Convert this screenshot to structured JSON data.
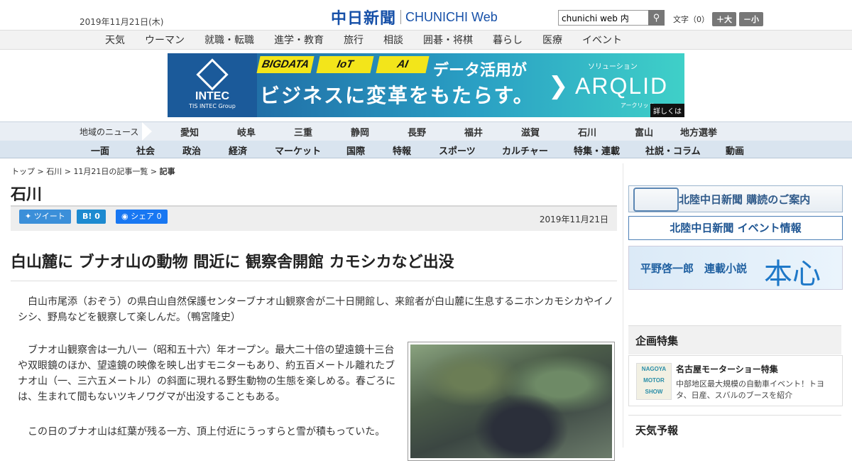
{
  "header": {
    "date": "2019年11月21日(木)",
    "logo_jp": "中日新聞",
    "logo_en": "CHUNICHI",
    "logo_web": "Web",
    "search_value": "chunichi web 内",
    "font_label": "文字（0）",
    "font_larger": "＋大",
    "font_smaller": "－小"
  },
  "service_nav": [
    "天気",
    "ウーマン",
    "就職・転職",
    "進学・教育",
    "旅行",
    "相談",
    "囲碁・将棋",
    "暮らし",
    "医療",
    "イベント"
  ],
  "ad": {
    "brand": "INTEC",
    "brand_sub": "TIS INTEC Group",
    "tags": [
      "BIGDATA",
      "IoT",
      "AI"
    ],
    "line1": "データ活用が",
    "line2": "ビジネスに変革をもたらす。",
    "solution": "ソリューション",
    "product": "ARQLID",
    "product_kana": "アークリッド",
    "more": "詳しくは"
  },
  "region_nav": {
    "lead": "地域のニュース",
    "items": [
      "愛知",
      "岐阜",
      "三重",
      "静岡",
      "長野",
      "福井",
      "滋賀",
      "石川",
      "富山",
      "地方選挙"
    ]
  },
  "category_nav": [
    "一面",
    "社会",
    "政治",
    "経済",
    "マーケット",
    "国際",
    "特報",
    "スポーツ",
    "カルチャー",
    "特集・連載",
    "社説・コラム",
    "動画"
  ],
  "breadcrumb": {
    "top": "トップ",
    "region": "石川",
    "list": "11月21日の記事一覧",
    "current": "記事"
  },
  "article": {
    "section": "石川",
    "tweet": "ツイート",
    "hatena": "B! 0",
    "fb": "シェア 0",
    "date": "2019年11月21日",
    "headline": "白山麓に ブナオ山の動物 間近に 観察舎開館 カモシカなど出没",
    "p1": "白山市尾添（おぞう）の県白山自然保護センターブナオ山観察舎が二十日開館し、来館者が白山麓に生息するニホンカモシカやイノシシ、野鳥などを観察して楽しんだ。（鴨宮隆史）",
    "p2": "ブナオ山観察舎は一九八一（昭和五十六）年オープン。最大二十倍の望遠鏡十三台や双眼鏡のほか、望遠鏡の映像を映し出すモニターもあり、約五百メートル離れたブナオ山（一、三六五メートル）の斜面に現れる野生動物の生態を楽しめる。春ごろには、生まれて間もないツキノワグマが出没することもある。",
    "p3": "この日のブナオ山は紅葉が残る一方、頂上付近にうっすらと雪が積もっていた。"
  },
  "sidebar": {
    "subscribe": "北陸中日新聞 購読のご案内",
    "events": "北陸中日新聞 イベント情報",
    "novel_author": "平野啓一郎　連載小説",
    "novel_title": "本心",
    "feature_heading": "企画特集",
    "feature_badge": [
      "NAGOYA",
      "MOTOR",
      "SHOW"
    ],
    "feature_title": "名古屋モーターショー特集",
    "feature_desc": "中部地区最大規模の自動車イベント！トヨタ、日産、スバルのブースを紹介",
    "weather_heading": "天気予報"
  }
}
